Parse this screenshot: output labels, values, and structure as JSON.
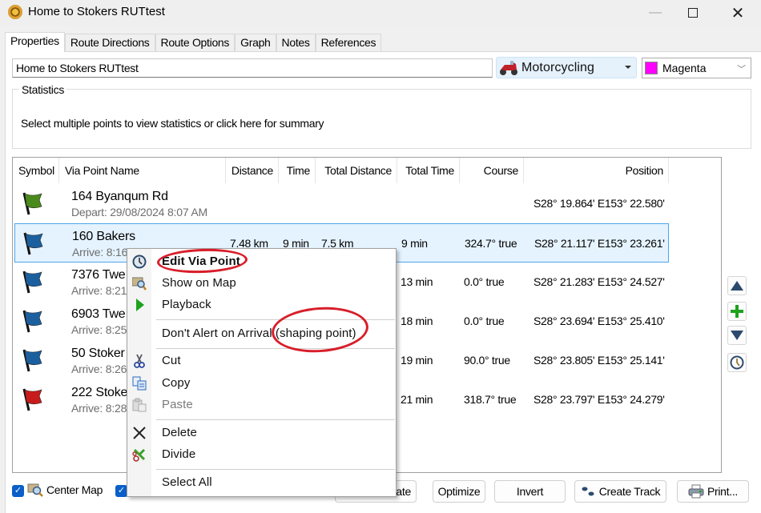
{
  "window": {
    "title": "Home to Stokers RUTtest",
    "controls": {
      "minimize": "—",
      "close": "✕"
    }
  },
  "tabs": [
    {
      "label": "Properties",
      "active": true
    },
    {
      "label": "Route Directions"
    },
    {
      "label": "Route Options"
    },
    {
      "label": "Graph"
    },
    {
      "label": "Notes"
    },
    {
      "label": "References"
    }
  ],
  "route": {
    "name": "Home to Stokers RUTtest",
    "activity": "Motorcycling",
    "color_label": "Magenta",
    "color_hex": "#ff00ff"
  },
  "statistics": {
    "title": "Statistics",
    "text": "Select multiple points to view statistics or click here for summary"
  },
  "table": {
    "columns": [
      "Symbol",
      "Via Point Name",
      "Distance",
      "Time",
      "Total Distance",
      "Total Time",
      "Course",
      "Position"
    ],
    "rows": [
      {
        "flag": "green-flag",
        "flag_color": "#4a8a1c",
        "name": "164 Byanqum Rd",
        "sub": "Depart: 29/08/2024 8:07 AM",
        "distance": "",
        "time": "",
        "total_distance": "",
        "total_time": "",
        "course": "",
        "position": "S28° 19.864' E153° 22.580'"
      },
      {
        "flag": "blue-flag",
        "flag_color": "#1c5f9e",
        "name": "160 Bakers",
        "sub": "Arrive: 8:16 AM",
        "distance": "7.48 km",
        "time": "9 min",
        "total_distance": "7.5 km",
        "total_time": "9 min",
        "course": "324.7° true",
        "position": "S28° 21.117' E153° 23.261'",
        "selected": true
      },
      {
        "flag": "blue-flag",
        "flag_color": "#1c5f9e",
        "name": "7376 Twe",
        "sub": "Arrive: 8:21",
        "distance": "",
        "time": "",
        "total_distance": "",
        "total_time": "13 min",
        "course": "0.0° true",
        "position": "S28° 21.283' E153° 24.527'"
      },
      {
        "flag": "blue-flag",
        "flag_color": "#1c5f9e",
        "name": "6903 Twe",
        "sub": "Arrive: 8:25",
        "distance": "",
        "time": "",
        "total_distance": "",
        "total_time": "18 min",
        "course": "0.0° true",
        "position": "S28° 23.694' E153° 25.410'"
      },
      {
        "flag": "blue-flag",
        "flag_color": "#1c5f9e",
        "name": "50 Stoker",
        "sub": "Arrive: 8:26",
        "distance": "",
        "time": "",
        "total_distance": "",
        "total_time": "19 min",
        "course": "90.0° true",
        "position": "S28° 23.805' E153° 25.141'"
      },
      {
        "flag": "red-flag",
        "flag_color": "#c81c1c",
        "name": "222 Stoke",
        "sub": "Arrive: 8:28",
        "distance": "",
        "time": "",
        "total_distance": "",
        "total_time": "21 min",
        "course": "318.7° true",
        "position": "S28° 23.797' E153° 24.279'"
      }
    ]
  },
  "side_buttons": [
    {
      "icon": "move-up-icon"
    },
    {
      "icon": "add-icon"
    },
    {
      "icon": "move-down-icon"
    },
    {
      "icon": "clock-icon"
    }
  ],
  "bottom": {
    "center_map_label": "Center Map",
    "center_map_checked": true,
    "second_checked": true,
    "recalculate_label": "late",
    "optimize_label": "Optimize",
    "invert_label": "Invert",
    "create_track_label": "Create Track",
    "print_label": "Print..."
  },
  "context_menu": {
    "items": [
      {
        "label": "Edit Via Point",
        "icon": "edit-via-point-icon",
        "bold": true
      },
      {
        "label": "Show on Map",
        "icon": "show-on-map-icon"
      },
      {
        "label": "Playback",
        "icon": "playback-icon"
      },
      {
        "separator": true
      },
      {
        "label": "Don't Alert on Arrival (shaping point)",
        "icon": ""
      },
      {
        "separator": true
      },
      {
        "label": "Cut",
        "icon": "cut-icon"
      },
      {
        "label": "Copy",
        "icon": "copy-icon"
      },
      {
        "label": "Paste",
        "icon": "paste-icon",
        "disabled": true
      },
      {
        "separator": true
      },
      {
        "label": "Delete",
        "icon": "delete-icon"
      },
      {
        "label": "Divide",
        "icon": "divide-icon"
      },
      {
        "separator": true
      },
      {
        "label": "Select All",
        "icon": ""
      }
    ]
  },
  "annotations": {
    "color": "#d81e2a"
  }
}
